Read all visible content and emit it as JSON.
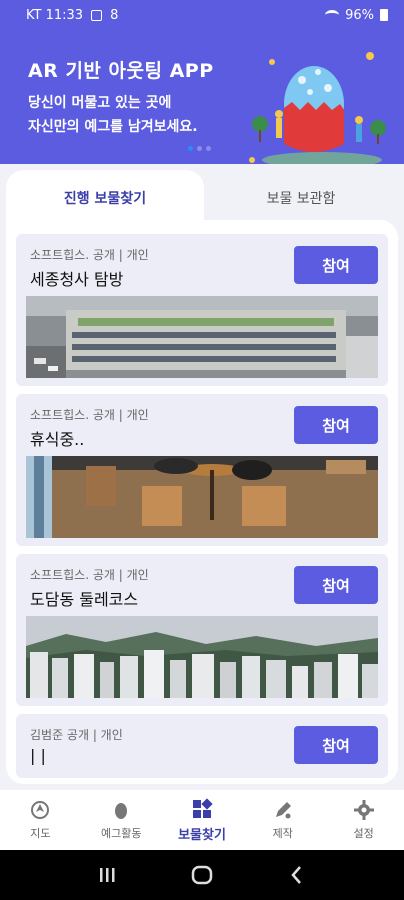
{
  "status_bar": {
    "carrier_time": "KT 11:33",
    "badge": "8",
    "battery": "96%"
  },
  "banner": {
    "title": "AR 기반 아웃팅 APP",
    "subtitle_line1": "당신이 머물고 있는 곳에",
    "subtitle_line2": "자신만의 예그를 남겨보세요."
  },
  "tabs": [
    {
      "label": "진행 보물찾기",
      "active": true
    },
    {
      "label": "보물 보관함",
      "active": false
    }
  ],
  "cards": [
    {
      "meta": "소프트힙스. 공개 | 개인",
      "title": "세종청사 탐방",
      "button": "참여",
      "image": "building-photo"
    },
    {
      "meta": "소프트힙스. 공개 | 개인",
      "title": "휴식중..",
      "button": "참여",
      "image": "cafe-photo"
    },
    {
      "meta": "소프트힙스. 공개 | 개인",
      "title": "도담동 둘레코스",
      "button": "참여",
      "image": "city-mountain-photo"
    },
    {
      "meta": "김범준 공개 | 개인",
      "title": "| |",
      "button": "참여",
      "image": ""
    }
  ],
  "bottom_nav": [
    {
      "label": "지도",
      "icon": "map-icon",
      "active": false
    },
    {
      "label": "예그활동",
      "icon": "egg-icon",
      "active": false
    },
    {
      "label": "보물찾기",
      "icon": "treasure-icon",
      "active": true
    },
    {
      "label": "제작",
      "icon": "create-icon",
      "active": false
    },
    {
      "label": "설정",
      "icon": "gear-icon",
      "active": false
    }
  ],
  "colors": {
    "primary": "#5b5ce0",
    "active_text": "#3c3faa",
    "card_bg": "#ededf7"
  }
}
